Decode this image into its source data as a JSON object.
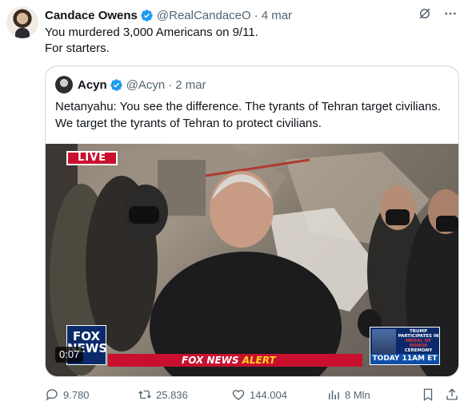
{
  "tweet": {
    "author_name": "Candace Owens",
    "handle": "@RealCandaceO",
    "separator": "·",
    "date": "4 mar",
    "text_line1": "You murdered 3,000 Americans on 9/11.",
    "text_line2": "For starters."
  },
  "quote": {
    "author_name": "Acyn",
    "handle": "@Acyn",
    "separator": "·",
    "date": "2 mar",
    "text": "Netanyahu: You see the difference. The tyrants of Tehran target civilians. We target the tyrants of Tehran to protect civilians."
  },
  "video": {
    "live_label": "LIVE",
    "fox_logo_line1": "FOX",
    "fox_logo_line2": "NEWS",
    "alert_brand": "FOX NEWS",
    "alert_word": "ALERT",
    "side_line1": "TRUMP",
    "side_line2": "PARTICIPATES IN",
    "side_line3": "MEDAL OF HONOR",
    "side_line4": "CEREMONY",
    "side_time": "TODAY 11AM ET",
    "timestamp": "0:07"
  },
  "actions": {
    "replies": "9.780",
    "reposts": "25.836",
    "likes": "144.004",
    "views": "8 Mln"
  },
  "icons": [
    "verified-badge-icon",
    "grok-icon",
    "more-icon",
    "reply-icon",
    "repost-icon",
    "like-icon",
    "views-icon",
    "bookmark-icon",
    "share-icon"
  ],
  "colors": {
    "verified": "#1d9bf0",
    "secondary_text": "#536471",
    "fox_red": "#c8102e"
  }
}
